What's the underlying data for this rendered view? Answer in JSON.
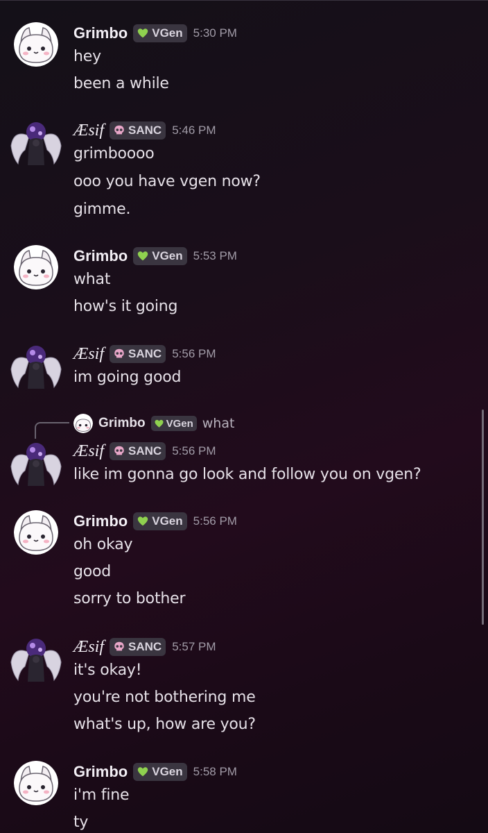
{
  "colors": {
    "vgen_heart": "#8fd14f",
    "sanc_skull": "#e8a6c8",
    "background": "#1a0c18"
  },
  "icons": {
    "grimbo_avatar": "white-cat-avatar",
    "aesif_avatar": "winged-figure-avatar",
    "vgen_tag_icon": "green-heart-icon",
    "sanc_tag_icon": "pink-skull-icon"
  },
  "messages": [
    {
      "author": "Grimbo",
      "tag": "VGen",
      "time": "5:30 PM",
      "lines": [
        "hey",
        "been a while"
      ]
    },
    {
      "author": "Æsif",
      "tag": "SANC",
      "time": "5:46 PM",
      "lines": [
        "grimboooo",
        "ooo you have vgen now?",
        "gimme."
      ]
    },
    {
      "author": "Grimbo",
      "tag": "VGen",
      "time": "5:53 PM",
      "lines": [
        "what",
        "how's it going"
      ]
    },
    {
      "author": "Æsif",
      "tag": "SANC",
      "time": "5:56 PM",
      "lines": [
        "im going good"
      ]
    },
    {
      "author": "Æsif",
      "tag": "SANC",
      "time": "5:56 PM",
      "lines": [
        "like im gonna go look and follow you on vgen?"
      ],
      "reply_to": {
        "author": "Grimbo",
        "tag": "VGen",
        "text": "what"
      }
    },
    {
      "author": "Grimbo",
      "tag": "VGen",
      "time": "5:56 PM",
      "lines": [
        "oh okay",
        "good",
        "sorry to bother"
      ]
    },
    {
      "author": "Æsif",
      "tag": "SANC",
      "time": "5:57 PM",
      "lines": [
        "it's okay!",
        "you're not bothering me",
        "what's up, how are you?"
      ]
    },
    {
      "author": "Grimbo",
      "tag": "VGen",
      "time": "5:58 PM",
      "lines": [
        "i'm fine",
        "ty"
      ]
    }
  ]
}
